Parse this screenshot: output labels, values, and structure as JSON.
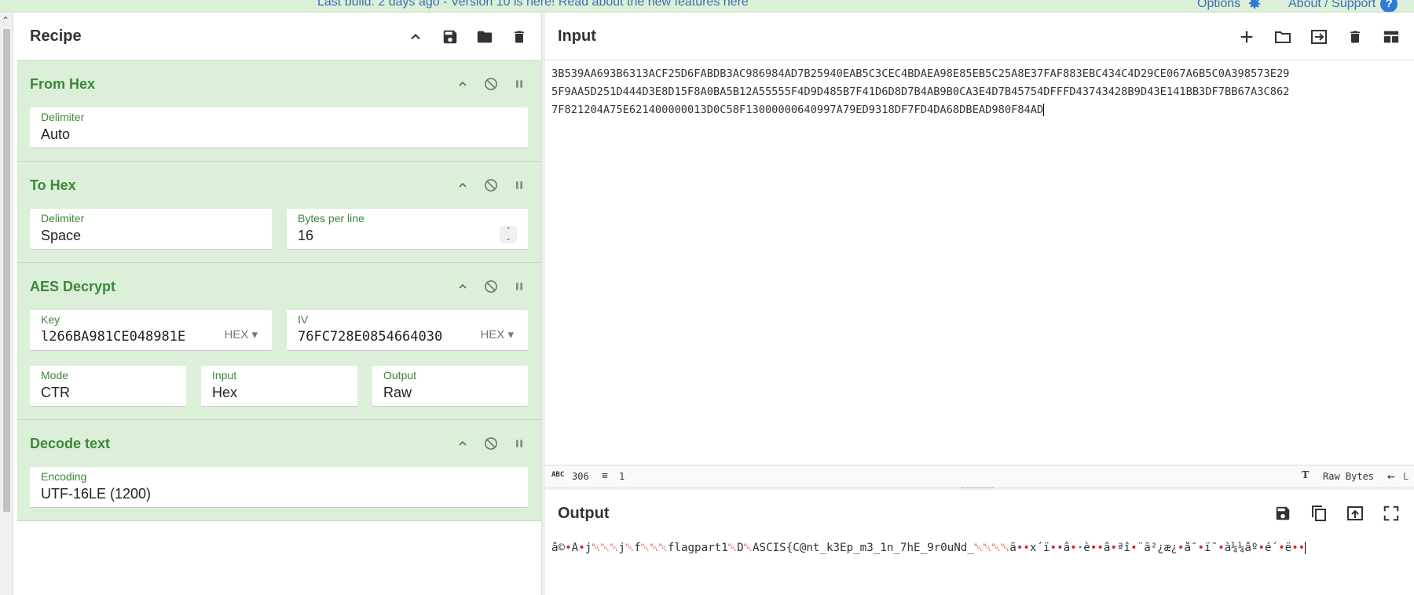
{
  "banner": {
    "notice": "Last build: 2 days ago - Version 10 is here! Read about the new features here",
    "options_label": "Options",
    "about_label": "About / Support",
    "help_badge": "?"
  },
  "recipe": {
    "title": "Recipe",
    "operations": [
      {
        "name": "From Hex",
        "fields": [
          {
            "label": "Delimiter",
            "value": "Auto"
          }
        ]
      },
      {
        "name": "To Hex",
        "fields": [
          {
            "label": "Delimiter",
            "value": "Space"
          },
          {
            "label": "Bytes per line",
            "value": "16"
          }
        ]
      },
      {
        "name": "AES Decrypt",
        "fields": [
          {
            "label": "Key",
            "value": "l266BA981CE048981E",
            "format": "HEX"
          },
          {
            "label": "IV",
            "value": "76FC728E0854664030",
            "format": "HEX"
          },
          {
            "label": "Mode",
            "value": "CTR"
          },
          {
            "label": "Input",
            "value": "Hex"
          },
          {
            "label": "Output",
            "value": "Raw"
          }
        ]
      },
      {
        "name": "Decode text",
        "fields": [
          {
            "label": "Encoding",
            "value": "UTF-16LE (1200)"
          }
        ]
      }
    ]
  },
  "input": {
    "title": "Input",
    "lines": [
      "3B539AA693B6313ACF25D6FABDB3AC986984AD7B25940EAB5C3CEC4BDAEA98E85EB5C25A8E37FAF883EBC434C4D29CE067A6B5C0A398573E29",
      "5F9AA5D251D444D3E8D15F8A0BA5B12A55555F4D9D485B7F41D6D8D7B4AB9B0CA3E4D7B45754DFFFD43743428B9D43E141BB3DF7BB67A3C862",
      "7F821204A75E621400000013D0C58F13000000640997A79ED9318DF7FD4DA68DBEAD980F84AD"
    ],
    "status": {
      "length": "306",
      "lines": "1",
      "encoding": "Raw Bytes",
      "eol": "L"
    }
  },
  "output": {
    "title": "Output",
    "segments": [
      {
        "t": "å©",
        "g": false
      },
      {
        "t": "•",
        "g": true
      },
      {
        "t": "Ä",
        "g": false
      },
      {
        "t": "•",
        "g": true
      },
      {
        "t": "j",
        "g": false
      },
      {
        "t": "␀␀␀",
        "g": true
      },
      {
        "t": "j",
        "g": false
      },
      {
        "t": "␀",
        "g": true
      },
      {
        "t": "f",
        "g": false
      },
      {
        "t": "␀␀␀",
        "g": true
      },
      {
        "t": "flagpart1",
        "g": false
      },
      {
        "t": "␀",
        "g": true
      },
      {
        "t": "D",
        "g": false
      },
      {
        "t": "␀",
        "g": true
      },
      {
        "t": "ASCIS{C@nt_k3Ep_m3_1n_7hE_9r0uNd_",
        "g": false
      },
      {
        "t": "␀␀␀␀",
        "g": true
      },
      {
        "t": "ã",
        "g": false
      },
      {
        "t": "••",
        "g": true
      },
      {
        "t": "x´ï",
        "g": false
      },
      {
        "t": "••",
        "g": true
      },
      {
        "t": "â",
        "g": false
      },
      {
        "t": "•",
        "g": true
      },
      {
        "t": "·è",
        "g": false
      },
      {
        "t": "••",
        "g": true
      },
      {
        "t": "â",
        "g": false
      },
      {
        "t": "•",
        "g": true
      },
      {
        "t": "ªî",
        "g": false
      },
      {
        "t": "•",
        "g": true
      },
      {
        "t": "¨ã²¿æ¿",
        "g": false
      },
      {
        "t": "•",
        "g": true
      },
      {
        "t": "å¯",
        "g": false
      },
      {
        "t": "•",
        "g": true
      },
      {
        "t": "ï¯",
        "g": false
      },
      {
        "t": "•",
        "g": true
      },
      {
        "t": "à¼¼åº",
        "g": false
      },
      {
        "t": "•",
        "g": true
      },
      {
        "t": "é´",
        "g": false
      },
      {
        "t": "•",
        "g": true
      },
      {
        "t": "ë",
        "g": false
      },
      {
        "t": "••",
        "g": true
      }
    ]
  }
}
